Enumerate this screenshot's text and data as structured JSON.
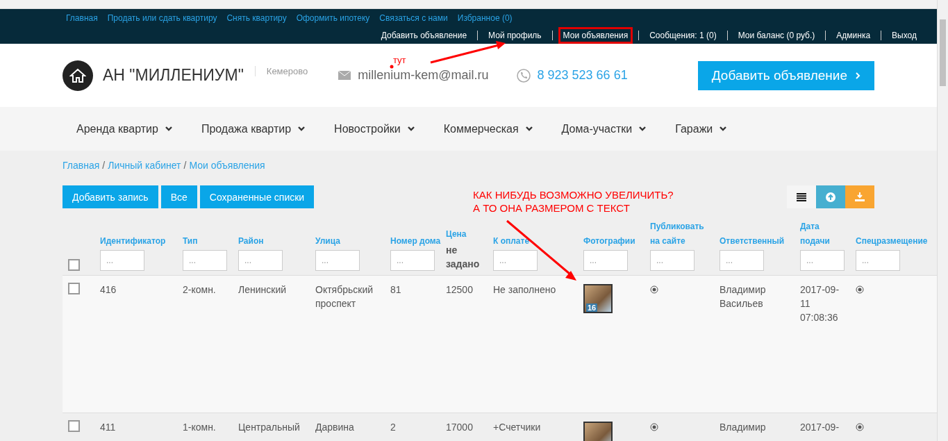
{
  "top_links": [
    {
      "label": "Главная"
    },
    {
      "label": "Продать или сдать квартиру"
    },
    {
      "label": "Снять квартиру"
    },
    {
      "label": "Оформить ипотеку"
    },
    {
      "label": "Связаться с нами"
    },
    {
      "label": "Избранное (0)"
    }
  ],
  "user_menu": [
    {
      "label": "Добавить объявление",
      "circled": false
    },
    {
      "label": "Мой профиль",
      "circled": false
    },
    {
      "label": "Мои объявления",
      "circled": true
    },
    {
      "label": "Сообщения: 1 (0)",
      "circled": false
    },
    {
      "label": "Мои баланс (0 руб.)",
      "circled": false
    },
    {
      "label": "Админка",
      "circled": false
    },
    {
      "label": "Выход",
      "circled": false
    }
  ],
  "header": {
    "brand": "АН \"МИЛЛЕНИУМ\"",
    "city": "Кемерово",
    "email": "millenium-kem@mail.ru",
    "phone": "8 923 523 66 61",
    "cta": "Добавить объявление"
  },
  "nav": [
    {
      "label": "Аренда квартир"
    },
    {
      "label": "Продажа квартир"
    },
    {
      "label": "Новостройки"
    },
    {
      "label": "Коммерческая"
    },
    {
      "label": "Дома-участки"
    },
    {
      "label": "Гаражи"
    }
  ],
  "breadcrumb": {
    "separator": "/",
    "items": [
      {
        "label": "Главная"
      },
      {
        "label": "Личный кабинет"
      },
      {
        "label": "Мои объявления"
      }
    ]
  },
  "actions": [
    {
      "label": "Добавить запись"
    },
    {
      "label": "Все"
    },
    {
      "label": "Сохраненные списки"
    }
  ],
  "table": {
    "all_checked": false,
    "columns": [
      {
        "label": "Идентификатор",
        "kind": "input",
        "placeholder": "..."
      },
      {
        "label": "Тип",
        "kind": "input",
        "placeholder": "..."
      },
      {
        "label": "Район",
        "kind": "input",
        "placeholder": "..."
      },
      {
        "label": "Улица",
        "kind": "input",
        "placeholder": "..."
      },
      {
        "label": "Номер дома",
        "kind": "input",
        "placeholder": "..."
      },
      {
        "label": "Цена",
        "kind": "text",
        "note": "не задано"
      },
      {
        "label": "К оплате",
        "kind": "input",
        "placeholder": "..."
      },
      {
        "label": "Фотографии",
        "kind": "input",
        "placeholder": "..."
      },
      {
        "label": "Публиковать на сайте",
        "kind": "input",
        "placeholder": "..."
      },
      {
        "label": "Ответственный",
        "kind": "input",
        "placeholder": "..."
      },
      {
        "label": "Дата подачи",
        "kind": "input",
        "placeholder": "..."
      },
      {
        "label": "Спецразмещение",
        "kind": "input",
        "placeholder": "..."
      }
    ],
    "rows": [
      {
        "checked": false,
        "id": "416",
        "type": "2-комн.",
        "district": "Ленинский",
        "street": "Октябрьский проспект",
        "house": "81",
        "price": "12500",
        "payment": "Не заполнено",
        "photo_count": "16",
        "responsible": "Владимир Васильев",
        "date": "2017-09-11 07:08:36"
      },
      {
        "checked": false,
        "id": "411",
        "type": "1-комн.",
        "district": "Центральный",
        "street": "Дарвина",
        "house": "2",
        "price": "17000",
        "payment": "+Счетчики",
        "responsible": "Владимир",
        "date": "2017-09-"
      }
    ]
  },
  "annotations": [
    {
      "lines": [
        "тут"
      ]
    },
    {
      "lines": [
        "КАК НИБУДЬ ВОЗМОЖНО УВЕЛИЧИТЬ?",
        "А ТО ОНА РАЗМЕРОМ С ТЕКСТ"
      ]
    }
  ]
}
